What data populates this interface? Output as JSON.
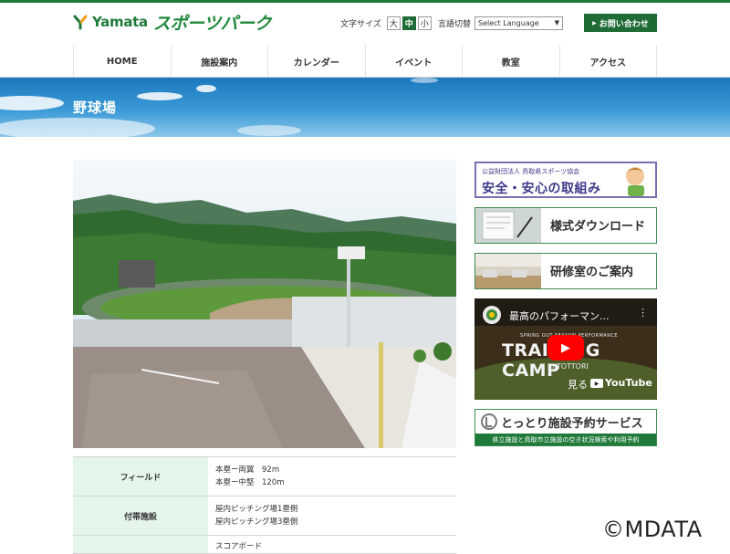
{
  "header": {
    "logo_en": "Yamata",
    "logo_jp": "スポーツパーク",
    "font_size_label": "文字サイズ",
    "font_size_options": [
      "大",
      "中",
      "小"
    ],
    "font_size_selected": "中",
    "language_label": "言語切替",
    "language_select_value": "Select Language",
    "contact_label": "お問い合わせ"
  },
  "nav": {
    "items": [
      "HOME",
      "施設案内",
      "カレンダー",
      "イベント",
      "教室",
      "アクセス"
    ]
  },
  "banner": {
    "title": "野球場"
  },
  "sidebar": {
    "banner1_line1": "公益財団法人 鳥取県スポーツ協会",
    "banner1_line2": "安全・安心の取組み",
    "banner2_label": "様式ダウンロード",
    "banner3_label": "研修室のご案内",
    "video_title": "最高のパフォーマン...",
    "video_overlay_top": "SPRING OUT-SEASON PERFORMANCE",
    "video_overlay_big": "TRAINING CAMP",
    "video_overlay_sub": "in TOTTORI",
    "video_watch_label": "見る",
    "video_platform": "YouTube",
    "banner4_label": "とっとり施設予約サービス",
    "banner4_sub": "県立施設と鳥取市立施設の空き状況検索や利用予約"
  },
  "table": {
    "rows": [
      {
        "header": "フィールド",
        "lines": [
          "本塁ー両翼　92m",
          "本塁ー中堅　120m"
        ]
      },
      {
        "header": "付帯施設",
        "lines": [
          "屋内ピッチング場1塁側",
          "屋内ピッチング場3塁側"
        ]
      },
      {
        "header": "",
        "lines": [
          "スコアボード"
        ]
      }
    ]
  },
  "watermark": "©MDATA",
  "colors": {
    "brand_green": "#1f6b35",
    "table_header_bg": "#e4f5ea",
    "banner_blue": "#1c78bd"
  }
}
